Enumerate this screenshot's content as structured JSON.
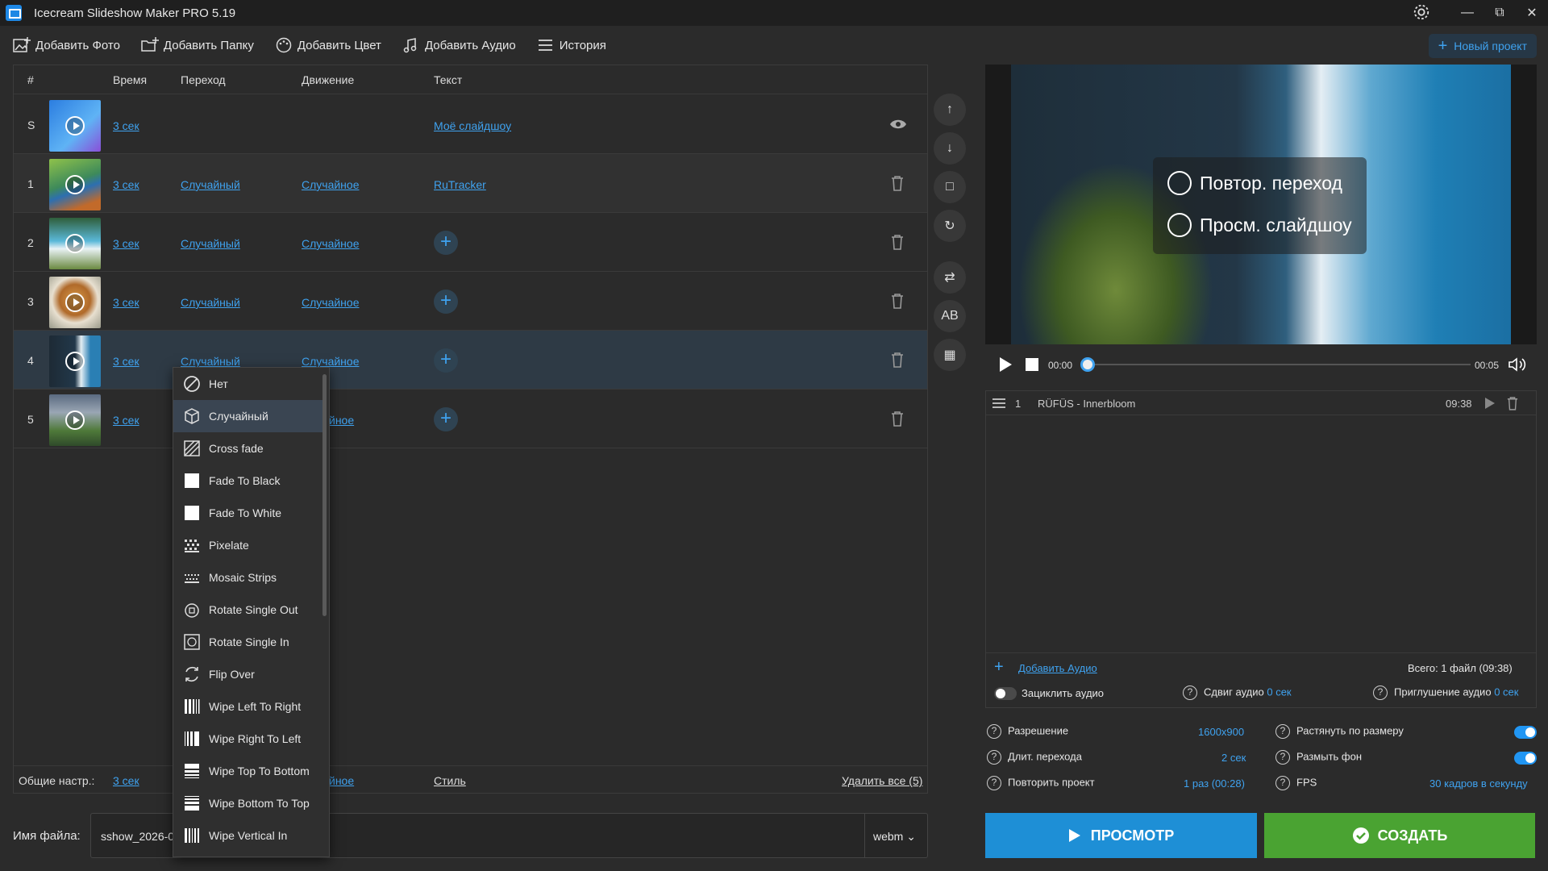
{
  "window": {
    "title": "Icecream Slideshow Maker PRO 5.19"
  },
  "toolbar": {
    "add_photo": "Добавить Фото",
    "add_folder": "Добавить Папку",
    "add_color": "Добавить Цвет",
    "add_audio": "Добавить Аудио",
    "history": "История",
    "new_project": "Новый проект"
  },
  "table": {
    "columns": [
      "#",
      "Время",
      "Переход",
      "Движение",
      "Текст"
    ],
    "rows": [
      {
        "num": "S",
        "time": "3 сек",
        "transition": "",
        "motion": "",
        "text": "Моё слайдшоу"
      },
      {
        "num": "1",
        "time": "3 сек",
        "transition": "Случайный",
        "motion": "Случайное",
        "text": "RuTracker"
      },
      {
        "num": "2",
        "time": "3 сек",
        "transition": "Случайный",
        "motion": "Случайное",
        "text": ""
      },
      {
        "num": "3",
        "time": "3 сек",
        "transition": "Случайный",
        "motion": "Случайное",
        "text": ""
      },
      {
        "num": "4",
        "time": "3 сек",
        "transition": "Случайный",
        "motion": "Случайное",
        "text": ""
      },
      {
        "num": "5",
        "time": "3 сек",
        "transition": "",
        "motion": "йное",
        "text": ""
      }
    ],
    "footer": {
      "label": "Общие настр.:",
      "time": "3 сек",
      "motion": "йное",
      "style": "Стиль",
      "delete_all": "Удалить все (5)"
    }
  },
  "dropdown": {
    "selected": "Случайный",
    "items": [
      "Нет",
      "Случайный",
      "Cross fade",
      "Fade To Black",
      "Fade To White",
      "Pixelate",
      "Mosaic Strips",
      "Rotate Single Out",
      "Rotate Single In",
      "Flip Over",
      "Wipe Left To Right",
      "Wipe Right To Left",
      "Wipe Top To Bottom",
      "Wipe Bottom To Top",
      "Wipe Vertical In"
    ]
  },
  "sidebar_buttons": {
    "ab_label": "AB"
  },
  "filename": {
    "label": "Имя файла:",
    "value": "sshow_2026-0",
    "format": "webm"
  },
  "preview": {
    "repeat_transition": "Повтор. переход",
    "view_slideshow": "Просм. слайдшоу",
    "time_current": "00:00",
    "time_total": "00:05",
    "progress": 0
  },
  "audio": {
    "track_num": "1",
    "track_name": "RÜFÜS - Innerbloom",
    "track_duration": "09:38",
    "add_audio": "Добавить Аудио",
    "total": "Всего: 1 файл (09:38)",
    "loop_label": "Зациклить аудио",
    "loop_on": false,
    "shift_label": "Сдвиг аудио",
    "shift_value": "0 сек",
    "fade_label": "Приглушение аудио",
    "fade_value": "0 сек"
  },
  "settings": {
    "resolution_label": "Разрешение",
    "resolution_value": "1600x900",
    "stretch_label": "Растянуть по размеру",
    "stretch_on": true,
    "transition_len_label": "Длит. перехода",
    "transition_len_value": "2 сек",
    "blur_label": "Размыть фон",
    "blur_on": true,
    "repeat_label": "Повторить проект",
    "repeat_value": "1 раз (00:28)",
    "fps_label": "FPS",
    "fps_value": "30 кадров в секунду"
  },
  "buttons": {
    "preview": "ПРОСМОТР",
    "create": "СОЗДАТЬ"
  },
  "colors": {
    "accent": "#3fa2ef",
    "preview_btn": "#1e8fd6",
    "create_btn": "#4aa332",
    "selected_row": "#2e3a45"
  }
}
